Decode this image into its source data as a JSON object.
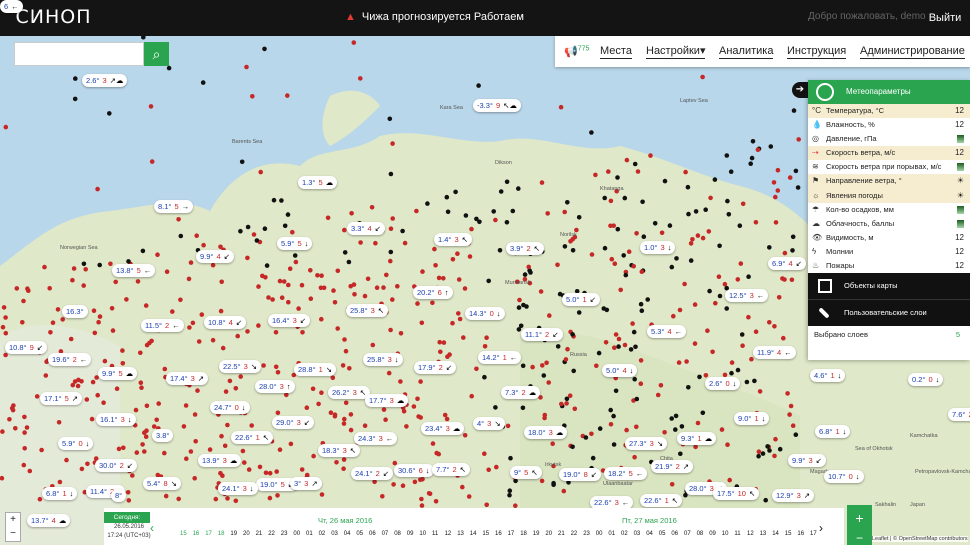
{
  "header": {
    "logo": "СИНОП",
    "alert": "Чижа прогнозируется Работаем",
    "welcome": "Добро пожаловать, demo",
    "logout": "Выйти"
  },
  "search": {
    "placeholder": ""
  },
  "menu": {
    "notif_count": "775",
    "items": [
      "Места",
      "Настройки",
      "Аналитика",
      "Инструкция",
      "Администрирование"
    ]
  },
  "panel": {
    "title": "Метеопараметры",
    "layers": [
      {
        "icon": "°C",
        "label": "Температура, °C",
        "value": "12",
        "hl": true
      },
      {
        "icon": "💧",
        "label": "Влажность, %",
        "value": "12",
        "hl": false
      },
      {
        "icon": "◎",
        "label": "Давление, гПа",
        "value": "",
        "hl": false
      },
      {
        "icon": "⇢",
        "label": "Скорость ветра, м/с",
        "value": "12",
        "hl": true
      },
      {
        "icon": "≋",
        "label": "Скорость ветра при порывах, м/с",
        "value": "",
        "hl": false
      },
      {
        "icon": "⚑",
        "label": "Направление ветра, °",
        "value": "☀",
        "hl": true
      },
      {
        "icon": "☼",
        "label": "Явления погоды",
        "value": "☀",
        "hl": true
      },
      {
        "icon": "☂",
        "label": "Кол-во осадков, мм",
        "value": "",
        "hl": false
      },
      {
        "icon": "☁",
        "label": "Облачность, баллы",
        "value": "",
        "hl": false
      },
      {
        "icon": "👁",
        "label": "Видимость, м",
        "value": "12",
        "hl": false
      },
      {
        "icon": "ϟ",
        "label": "Молнии",
        "value": "12",
        "hl": false
      },
      {
        "icon": "♨",
        "label": "Пожары",
        "value": "12",
        "hl": false
      }
    ],
    "objects": "Объекты карты",
    "userlayers": "Пользовательские слои",
    "selected_label": "Выбрано слоев",
    "selected_count": "5"
  },
  "map_labels": [
    "Kara Sea",
    "Laptev Sea",
    "Barents Sea",
    "Norwegian Sea",
    "Russia",
    "Sea of Okhotsk",
    "Khatanga",
    "Dikson",
    "Murmansk",
    "Kamchatka",
    "Ulaanbaatar",
    "Magadan",
    "Yakutsk",
    "Norilsk",
    "Chita",
    "Sakhalin",
    "Irkutsk",
    "Japan",
    "Petropavlovsk-Kamchatsky"
  ],
  "bubbles": [
    {
      "t": "2.6°",
      "w": "3",
      "a": "↗☁"
    },
    {
      "t": "-3.3°",
      "w": "9",
      "a": "↖☁"
    },
    {
      "t": "1.3°",
      "w": "5",
      "a": "☁"
    },
    {
      "t": "8.1°",
      "w": "5",
      "a": "→"
    },
    {
      "t": "3.3°",
      "w": "4",
      "a": "↙"
    },
    {
      "t": "1.4°",
      "w": "3",
      "a": "↖"
    },
    {
      "t": "3.9°",
      "w": "2",
      "a": "↖"
    },
    {
      "t": "1.0°",
      "w": "3",
      "a": "↓"
    },
    {
      "t": "6.9°",
      "w": "4",
      "a": "↙"
    },
    {
      "t": "5.9°",
      "w": "5",
      "a": "↓"
    },
    {
      "t": "9.9°",
      "w": "4",
      "a": "↙"
    },
    {
      "t": "13.8°",
      "w": "5",
      "a": "←"
    },
    {
      "t": "20.2°",
      "w": "6",
      "a": "↑"
    },
    {
      "t": "5.0°",
      "w": "1",
      "a": "↙"
    },
    {
      "t": "12.5°",
      "w": "3",
      "a": "←"
    },
    {
      "t": "16.3°",
      "w": "",
      "a": ""
    },
    {
      "t": "11.5°",
      "w": "2",
      "a": "←"
    },
    {
      "t": "10.8°",
      "w": "4",
      "a": "↙"
    },
    {
      "t": "16.4°",
      "w": "3",
      "a": "↙"
    },
    {
      "t": "25.8°",
      "w": "3",
      "a": "↖"
    },
    {
      "t": "14.3°",
      "w": "0",
      "a": "↓"
    },
    {
      "t": "5.3°",
      "w": "4",
      "a": "←"
    },
    {
      "t": "11.1°",
      "w": "2",
      "a": "↙"
    },
    {
      "t": "10.8°",
      "w": "9",
      "a": "↙"
    },
    {
      "t": "19.6°",
      "w": "2",
      "a": "←"
    },
    {
      "t": "25.8°",
      "w": "3",
      "a": "↓"
    },
    {
      "t": "14.2°",
      "w": "1",
      "a": "←"
    },
    {
      "t": "11.9°",
      "w": "4",
      "a": "←"
    },
    {
      "t": "9.9°",
      "w": "5",
      "a": "☁"
    },
    {
      "t": "17.4°",
      "w": "3",
      "a": "↗"
    },
    {
      "t": "22.5°",
      "w": "3",
      "a": "↘"
    },
    {
      "t": "28.8°",
      "w": "1",
      "a": "↘"
    },
    {
      "t": "17.9°",
      "w": "2",
      "a": "↙"
    },
    {
      "t": "5.0°",
      "w": "4",
      "a": "↓"
    },
    {
      "t": "28.0°",
      "w": "3",
      "a": "↑"
    },
    {
      "t": "26.2°",
      "w": "3",
      "a": "↖"
    },
    {
      "t": "7.3°",
      "w": "2",
      "a": "☁"
    },
    {
      "t": "2.6°",
      "w": "0",
      "a": "↓"
    },
    {
      "t": "4.6°",
      "w": "1",
      "a": "↓"
    },
    {
      "t": "0.2°",
      "w": "0",
      "a": "↓"
    },
    {
      "t": "17.1°",
      "w": "5",
      "a": "↗"
    },
    {
      "t": "24.7°",
      "w": "0",
      "a": "↓"
    },
    {
      "t": "17.7°",
      "w": "3",
      "a": "☁"
    },
    {
      "t": "9.0°",
      "w": "1",
      "a": "↓"
    },
    {
      "t": "16.1°",
      "w": "3",
      "a": "↓"
    },
    {
      "t": "29.0°",
      "w": "3",
      "a": "↙"
    },
    {
      "t": "23.4°",
      "w": "3",
      "a": "☁"
    },
    {
      "t": "4°",
      "w": "3",
      "a": "↘"
    },
    {
      "t": "18.0°",
      "w": "3",
      "a": "☁"
    },
    {
      "t": "6.8°",
      "w": "1",
      "a": "↓"
    },
    {
      "t": "7.6°",
      "w": "2",
      "a": "↙"
    },
    {
      "t": "3.8°",
      "w": "",
      "a": ""
    },
    {
      "t": "22.6°",
      "w": "1",
      "a": "↖"
    },
    {
      "t": "24.3°",
      "w": "3",
      "a": "←"
    },
    {
      "t": "27.3°",
      "w": "3",
      "a": "↘"
    },
    {
      "t": "9.3°",
      "w": "1",
      "a": "☁"
    },
    {
      "t": "5.9°",
      "w": "0",
      "a": "↓"
    },
    {
      "t": "18.3°",
      "w": "3",
      "a": "↖"
    },
    {
      "t": "30.0°",
      "w": "2",
      "a": "↙"
    },
    {
      "t": "13.9°",
      "w": "3",
      "a": "☁"
    },
    {
      "t": "24.1°",
      "w": "2",
      "a": "↙"
    },
    {
      "t": "30.6°",
      "w": "6",
      "a": "↓"
    },
    {
      "t": "7.7°",
      "w": "2",
      "a": "↖"
    },
    {
      "t": "9°",
      "w": "5",
      "a": "↖"
    },
    {
      "t": "19.0°",
      "w": "8",
      "a": "↙"
    },
    {
      "t": "18.2°",
      "w": "5",
      "a": "←"
    },
    {
      "t": "21.9°",
      "w": "2",
      "a": "↗"
    },
    {
      "t": "9.9°",
      "w": "3",
      "a": "↙"
    },
    {
      "t": "10.7°",
      "w": "0",
      "a": "↓"
    },
    {
      "t": "5.4°",
      "w": "8",
      "a": "↘"
    },
    {
      "t": "19.0°",
      "w": "5",
      "a": "↙"
    },
    {
      "t": "3°",
      "w": "3",
      "a": "↗"
    },
    {
      "t": "28.0°",
      "w": "3",
      "a": "↙"
    },
    {
      "t": "6.8°",
      "w": "1",
      "a": "↓"
    },
    {
      "t": "11.4°",
      "w": "2",
      "a": "↓"
    },
    {
      "t": "8°",
      "w": "",
      "a": ""
    },
    {
      "t": "24.1°",
      "w": "3",
      "a": "↓"
    },
    {
      "t": "22.6°",
      "w": "3",
      "a": "←"
    },
    {
      "t": "22.6°",
      "w": "1",
      "a": "↖"
    },
    {
      "t": "17.5°",
      "w": "10",
      "a": "↖"
    },
    {
      "t": "12.9°",
      "w": "3",
      "a": "↗"
    },
    {
      "t": "13.7°",
      "w": "4",
      "a": "☁"
    },
    {
      "t": "6",
      "w": "",
      "a": "←"
    }
  ],
  "timeline": {
    "today_label": "Сегодня:",
    "today_date": "26.05.2016",
    "today_time": "17:24 (UTC+03)",
    "day1": "Чт, 26 мая 2016",
    "day2": "Пт, 27 мая 2016",
    "hours": [
      "15",
      "16",
      "17",
      "18",
      "19",
      "20",
      "21",
      "22",
      "23",
      "00",
      "01",
      "02",
      "03",
      "04",
      "05",
      "06",
      "07",
      "08",
      "09",
      "10",
      "11",
      "12",
      "13",
      "14",
      "15",
      "16",
      "17",
      "18",
      "19",
      "20",
      "21",
      "22",
      "23",
      "00",
      "01",
      "02",
      "03",
      "04",
      "05",
      "06",
      "07",
      "08",
      "09",
      "10",
      "11",
      "12",
      "13",
      "14",
      "15",
      "16",
      "17"
    ]
  },
  "attribution": "Leaflet | © OpenStreetMap contributors",
  "colors": {
    "accent": "#2aa44f",
    "topbar": "#141414",
    "alert": "#e53935"
  }
}
